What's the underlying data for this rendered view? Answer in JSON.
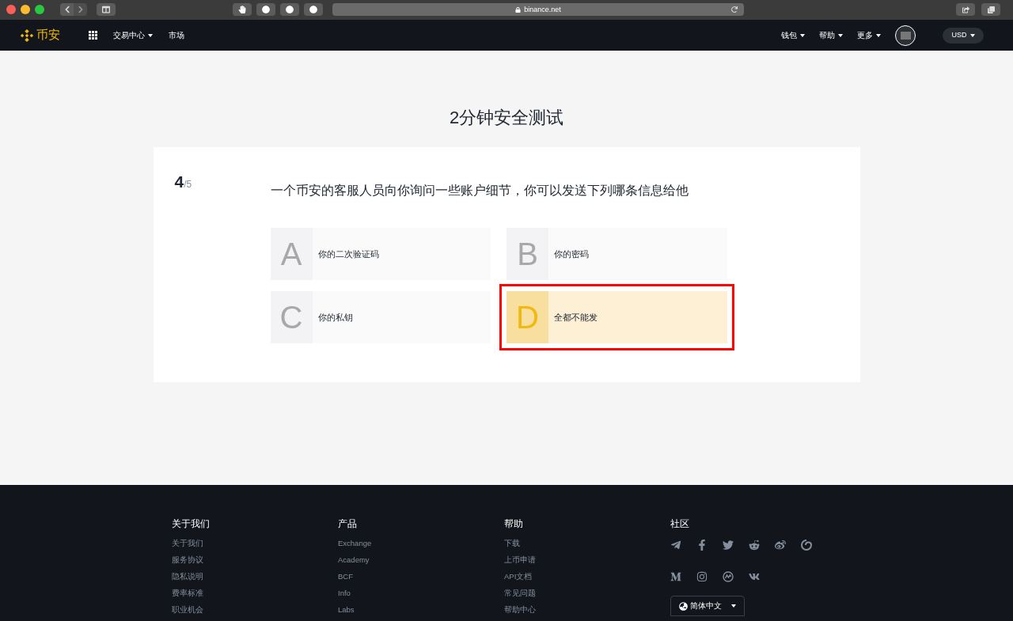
{
  "browser": {
    "url": "binance.net"
  },
  "nav": {
    "logo": "币安",
    "left": [
      {
        "label": "交易中心",
        "dropdown": true
      },
      {
        "label": "市场",
        "dropdown": false
      }
    ],
    "right": [
      {
        "label": "钱包",
        "dropdown": true
      },
      {
        "label": "帮助",
        "dropdown": true
      },
      {
        "label": "更多",
        "dropdown": true
      }
    ],
    "currency": "USD"
  },
  "title": "2分钟安全测试",
  "quiz": {
    "current": "4",
    "total": "/5",
    "question": "一个币安的客服人员向你询问一些账户细节，你可以发送下列哪条信息给他",
    "options": [
      {
        "letter": "A",
        "text": "你的二次验证码",
        "selected": false
      },
      {
        "letter": "B",
        "text": "你的密码",
        "selected": false
      },
      {
        "letter": "C",
        "text": "你的私钥",
        "selected": false
      },
      {
        "letter": "D",
        "text": "全都不能发",
        "selected": true
      }
    ]
  },
  "footer": {
    "columns": [
      {
        "heading": "关于我们",
        "links": [
          "关于我们",
          "服务协议",
          "隐私说明",
          "费率标准",
          "职业机会"
        ]
      },
      {
        "heading": "产品",
        "links": [
          "Exchange",
          "Academy",
          "BCF",
          "Info",
          "Labs"
        ]
      },
      {
        "heading": "帮助",
        "links": [
          "下载",
          "上币申请",
          "API文档",
          "常见问题",
          "帮助中心"
        ]
      }
    ],
    "community": {
      "heading": "社区"
    },
    "language": "简体中文"
  }
}
